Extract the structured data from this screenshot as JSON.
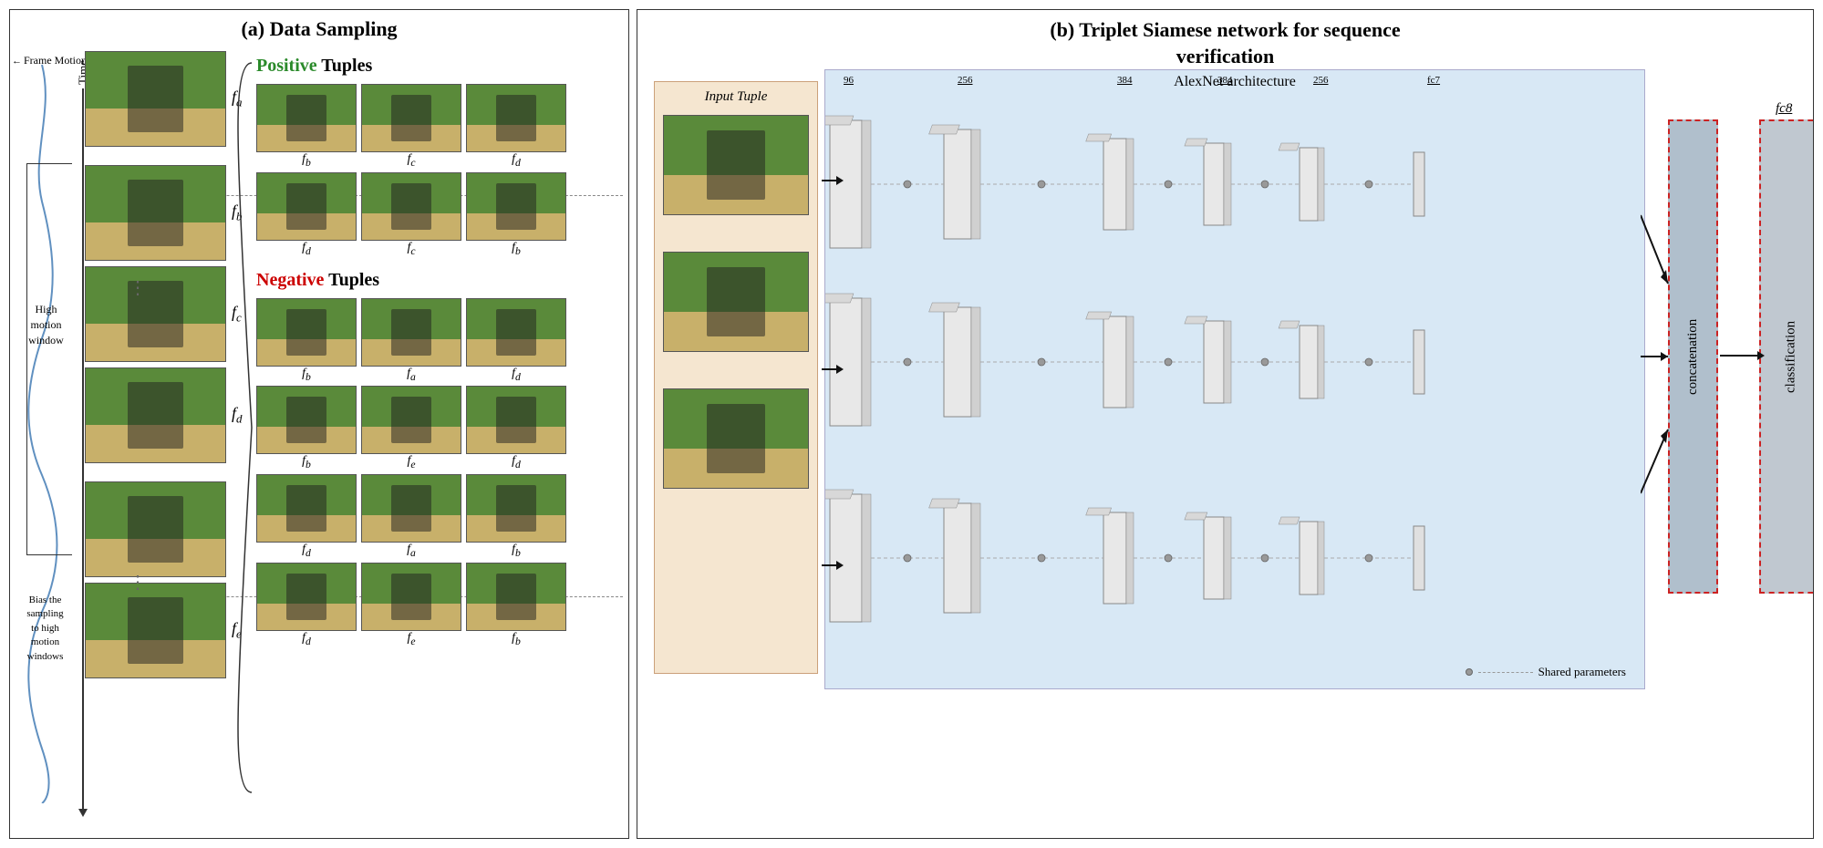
{
  "page": {
    "background": "#ffffff"
  },
  "left_panel": {
    "title": "(a) Data Sampling",
    "frame_motion_label": "Frame Motion",
    "time_label": "Time",
    "high_motion_label": "High\nmotion\nwindow",
    "bias_label": "Bias the\nsampling\nto high\nmotion\nwindows",
    "frames": [
      {
        "id": "fa",
        "label": "f",
        "sub": "a"
      },
      {
        "id": "fb",
        "label": "f",
        "sub": "b"
      },
      {
        "id": "fc",
        "label": "f",
        "sub": "c"
      },
      {
        "id": "fd",
        "label": "f",
        "sub": "d"
      },
      {
        "id": "fe1",
        "label": "",
        "sub": ""
      },
      {
        "id": "fe2",
        "label": "f",
        "sub": "e"
      }
    ],
    "positive_tuples": {
      "title": "Positive Tuples",
      "groups": [
        {
          "labels": [
            "f_b",
            "f_c",
            "f_d"
          ]
        },
        {
          "labels": [
            "f_d",
            "f_c",
            "f_b"
          ]
        }
      ]
    },
    "negative_tuples": {
      "title": "Negative Tuples",
      "groups": [
        {
          "labels": [
            "f_b",
            "f_a",
            "f_d"
          ]
        },
        {
          "labels": [
            "f_b",
            "f_e",
            "f_d"
          ]
        },
        {
          "labels": [
            "f_d",
            "f_a",
            "f_b"
          ]
        },
        {
          "labels": [
            "f_d",
            "f_e",
            "f_b"
          ]
        }
      ]
    }
  },
  "right_panel": {
    "title_line1": "(b) Triplet Siamese network for sequence",
    "title_line2": "verification",
    "input_tuple_label": "Input Tuple",
    "alexnet_label": "AlexNet architecture",
    "layer_numbers": [
      "96",
      "256",
      "384",
      "384",
      "256"
    ],
    "fc7_label": "fc7",
    "fc8_label": "fc8",
    "concatenation_label": "concatenation",
    "classification_label": "classification",
    "shared_params_label": "Shared parameters"
  }
}
